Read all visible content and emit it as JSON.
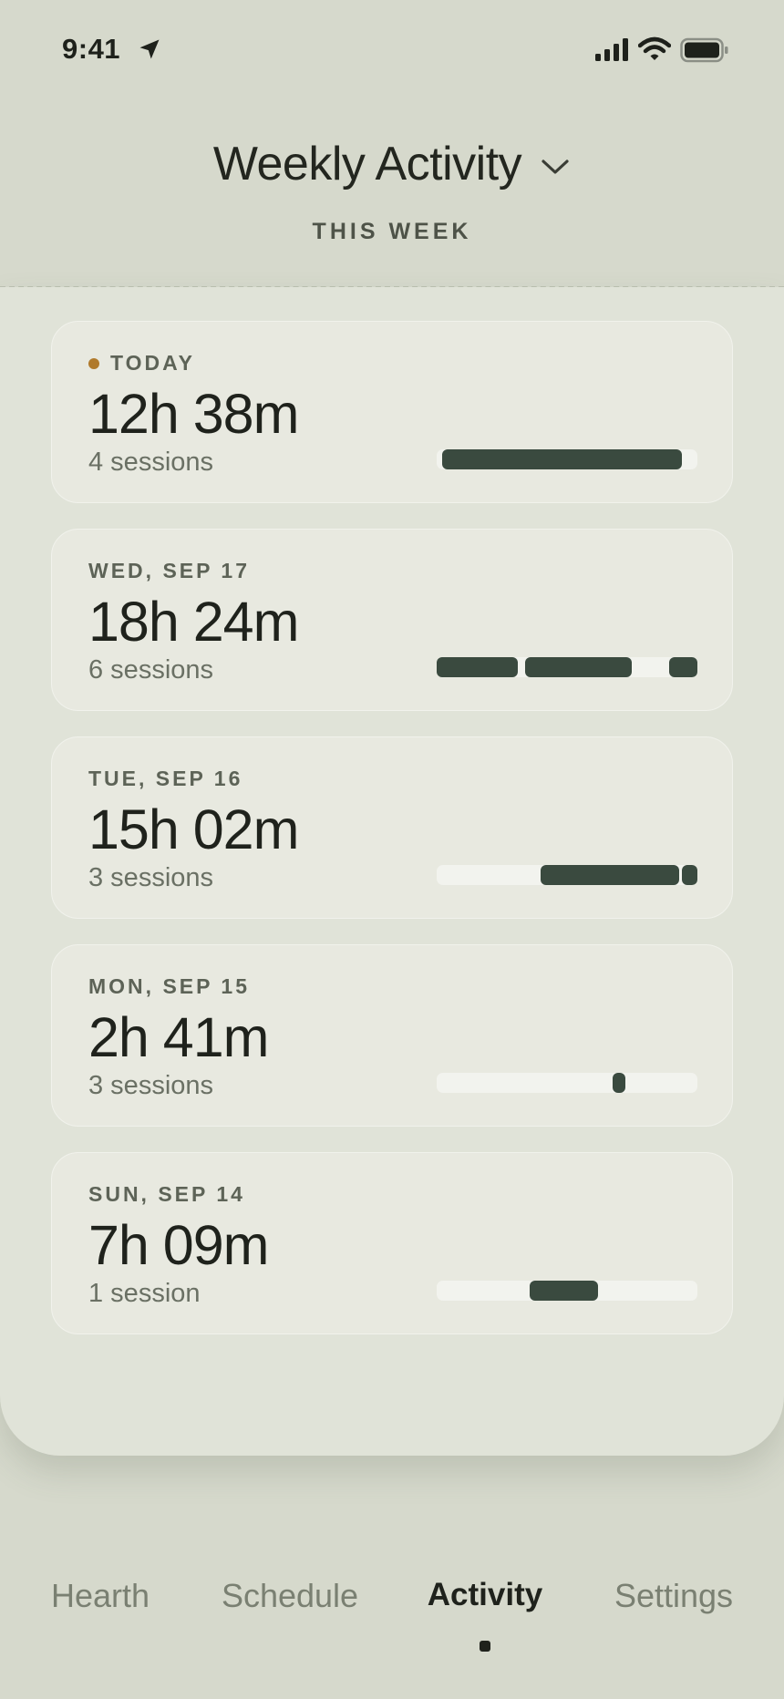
{
  "status_bar": {
    "time": "9:41",
    "icons": [
      "location-arrow-icon",
      "cellular-signal-icon",
      "wifi-icon",
      "battery-icon"
    ]
  },
  "header": {
    "title": "Weekly Activity",
    "subtitle": "THIS WEEK",
    "dropdown_icon": "chevron-down-icon"
  },
  "colors": {
    "background": "#d6d9cc",
    "sheet": "#e0e3d8",
    "card": "#e8e9e0",
    "bar_fill": "#3a4a3f",
    "bar_track": "#f2f3ee",
    "today_dot": "#b07a2c"
  },
  "days": [
    {
      "label": "TODAY",
      "is_today": true,
      "duration": "12h 38m",
      "sessions": "4 sessions",
      "activity_segments": [
        [
          0.02,
          0.94
        ]
      ]
    },
    {
      "label": "WED, SEP 17",
      "is_today": false,
      "duration": "18h 24m",
      "sessions": "6 sessions",
      "activity_segments": [
        [
          0.0,
          0.31
        ],
        [
          0.34,
          0.75
        ],
        [
          0.89,
          1.0
        ]
      ]
    },
    {
      "label": "TUE, SEP 16",
      "is_today": false,
      "duration": "15h 02m",
      "sessions": "3 sessions",
      "activity_segments": [
        [
          0.4,
          0.93
        ],
        [
          0.94,
          1.0
        ]
      ]
    },
    {
      "label": "MON, SEP 15",
      "is_today": false,
      "duration": "2h 41m",
      "sessions": "3 sessions",
      "activity_segments": [
        [
          0.675,
          0.725
        ]
      ]
    },
    {
      "label": "SUN, SEP 14",
      "is_today": false,
      "duration": "7h 09m",
      "sessions": "1 session",
      "activity_segments": [
        [
          0.355,
          0.62
        ]
      ]
    }
  ],
  "tabs": [
    {
      "label": "Hearth",
      "active": false
    },
    {
      "label": "Schedule",
      "active": false
    },
    {
      "label": "Activity",
      "active": true
    },
    {
      "label": "Settings",
      "active": false
    }
  ]
}
